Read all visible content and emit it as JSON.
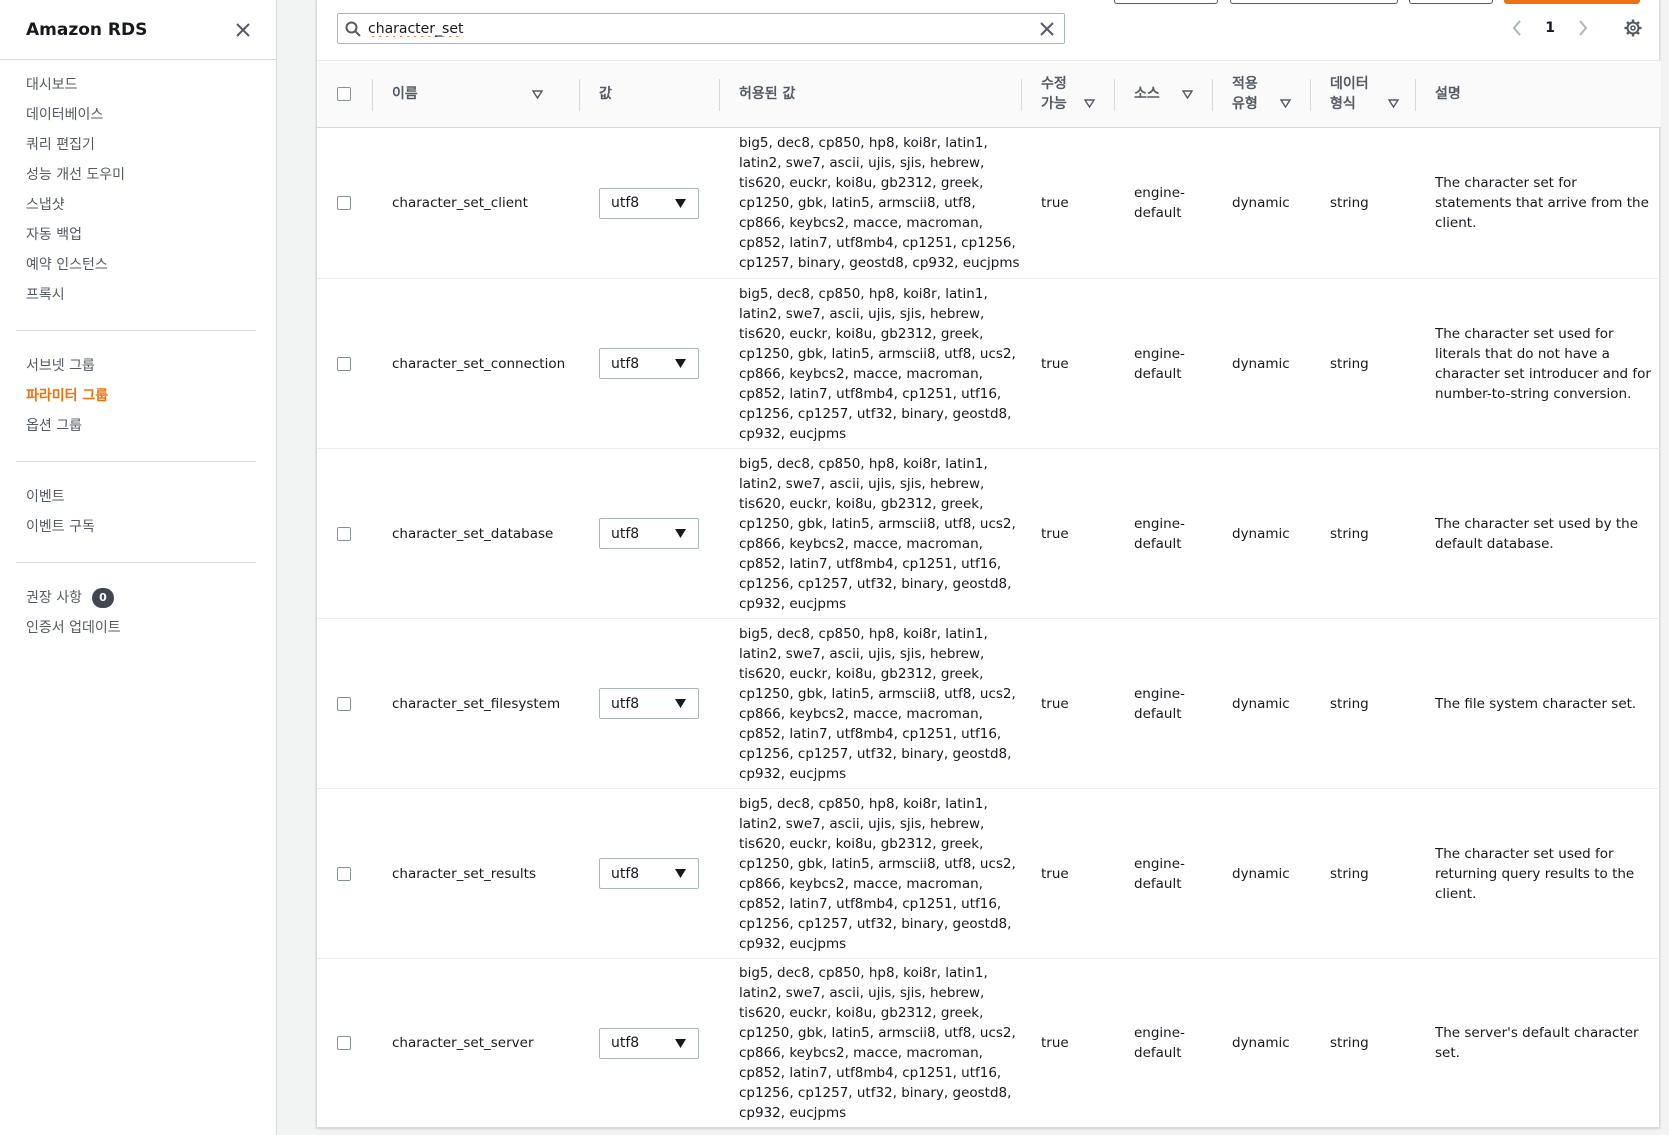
{
  "sidebar": {
    "title": "Amazon RDS",
    "group1": [
      "대시보드",
      "데이터베이스",
      "쿼리 편집기",
      "성능 개선 도우미",
      "스냅샷",
      "자동 백업",
      "예약 인스턴스",
      "프록시"
    ],
    "group2": [
      "서브넷 그룹",
      "파라미터 그룹",
      "옵션 그룹"
    ],
    "group3": [
      "이벤트",
      "이벤트 구독"
    ],
    "group4": [
      "권장 사항",
      "인증서 업데이트"
    ],
    "recommend_count": "0"
  },
  "search": {
    "value": "character_set"
  },
  "pagination": {
    "current_page": "1"
  },
  "table": {
    "headers": {
      "name": "이름",
      "value": "값",
      "allowed": "허용된 값",
      "modifiable": "수정\n가능",
      "source": "소스",
      "apply_type": "적용\n유형",
      "data_type": "데이터\n형식",
      "description": "설명"
    },
    "rows": [
      {
        "name": "character_set_client",
        "value": "utf8",
        "allowed": "big5, dec8, cp850, hp8, koi8r, latin1,\nlatin2, swe7, ascii, ujis, sjis, hebrew,\ntis620, euckr, koi8u, gb2312, greek,\ncp1250, gbk, latin5, armscii8, utf8,\ncp866, keybcs2, macce, macroman,\ncp852, latin7, utf8mb4, cp1251, cp1256,\ncp1257, binary, geostd8, cp932, eucjpms",
        "modifiable": "true",
        "source": "engine-\ndefault",
        "apply_type": "dynamic",
        "data_type": "string",
        "description": "The character set for statements that arrive from the client."
      },
      {
        "name": "character_set_connection",
        "value": "utf8",
        "allowed": "big5, dec8, cp850, hp8, koi8r, latin1,\nlatin2, swe7, ascii, ujis, sjis, hebrew,\ntis620, euckr, koi8u, gb2312, greek,\ncp1250, gbk, latin5, armscii8, utf8, ucs2,\ncp866, keybcs2, macce, macroman,\ncp852, latin7, utf8mb4, cp1251, utf16,\ncp1256, cp1257, utf32, binary, geostd8,\ncp932, eucjpms",
        "modifiable": "true",
        "source": "engine-\ndefault",
        "apply_type": "dynamic",
        "data_type": "string",
        "description": "The character set used for literals that do not have a character set introducer and for number-to-string conversion."
      },
      {
        "name": "character_set_database",
        "value": "utf8",
        "allowed": "big5, dec8, cp850, hp8, koi8r, latin1,\nlatin2, swe7, ascii, ujis, sjis, hebrew,\ntis620, euckr, koi8u, gb2312, greek,\ncp1250, gbk, latin5, armscii8, utf8, ucs2,\ncp866, keybcs2, macce, macroman,\ncp852, latin7, utf8mb4, cp1251, utf16,\ncp1256, cp1257, utf32, binary, geostd8,\ncp932, eucjpms",
        "modifiable": "true",
        "source": "engine-\ndefault",
        "apply_type": "dynamic",
        "data_type": "string",
        "description": "The character set used by the default database."
      },
      {
        "name": "character_set_filesystem",
        "value": "utf8",
        "allowed": "big5, dec8, cp850, hp8, koi8r, latin1,\nlatin2, swe7, ascii, ujis, sjis, hebrew,\ntis620, euckr, koi8u, gb2312, greek,\ncp1250, gbk, latin5, armscii8, utf8, ucs2,\ncp866, keybcs2, macce, macroman,\ncp852, latin7, utf8mb4, cp1251, utf16,\ncp1256, cp1257, utf32, binary, geostd8,\ncp932, eucjpms",
        "modifiable": "true",
        "source": "engine-\ndefault",
        "apply_type": "dynamic",
        "data_type": "string",
        "description": "The file system character set."
      },
      {
        "name": "character_set_results",
        "value": "utf8",
        "allowed": "big5, dec8, cp850, hp8, koi8r, latin1,\nlatin2, swe7, ascii, ujis, sjis, hebrew,\ntis620, euckr, koi8u, gb2312, greek,\ncp1250, gbk, latin5, armscii8, utf8, ucs2,\ncp866, keybcs2, macce, macroman,\ncp852, latin7, utf8mb4, cp1251, utf16,\ncp1256, cp1257, utf32, binary, geostd8,\ncp932, eucjpms",
        "modifiable": "true",
        "source": "engine-\ndefault",
        "apply_type": "dynamic",
        "data_type": "string",
        "description": "The character set used for returning query results to the client."
      },
      {
        "name": "character_set_server",
        "value": "utf8",
        "allowed": "big5, dec8, cp850, hp8, koi8r, latin1,\nlatin2, swe7, ascii, ujis, sjis, hebrew,\ntis620, euckr, koi8u, gb2312, greek,\ncp1250, gbk, latin5, armscii8, utf8, ucs2,\ncp866, keybcs2, macce, macroman,\ncp852, latin7, utf8mb4, cp1251, utf16,\ncp1256, cp1257, utf32, binary, geostd8,\ncp932, eucjpms",
        "modifiable": "true",
        "source": "engine-\ndefault",
        "apply_type": "dynamic",
        "data_type": "string",
        "description": "The server's default character set."
      }
    ]
  },
  "colors": {
    "accent": "#ec7211",
    "border": "#d5dbdb",
    "text": "#16191f",
    "muted": "#545b64"
  },
  "icons": {
    "close": "close-icon",
    "search": "search-icon",
    "clear": "clear-icon",
    "prev": "chevron-left-icon",
    "next": "chevron-right-icon",
    "settings": "gear-icon",
    "sort": "sort-down-icon",
    "dropdown": "caret-down-icon"
  }
}
